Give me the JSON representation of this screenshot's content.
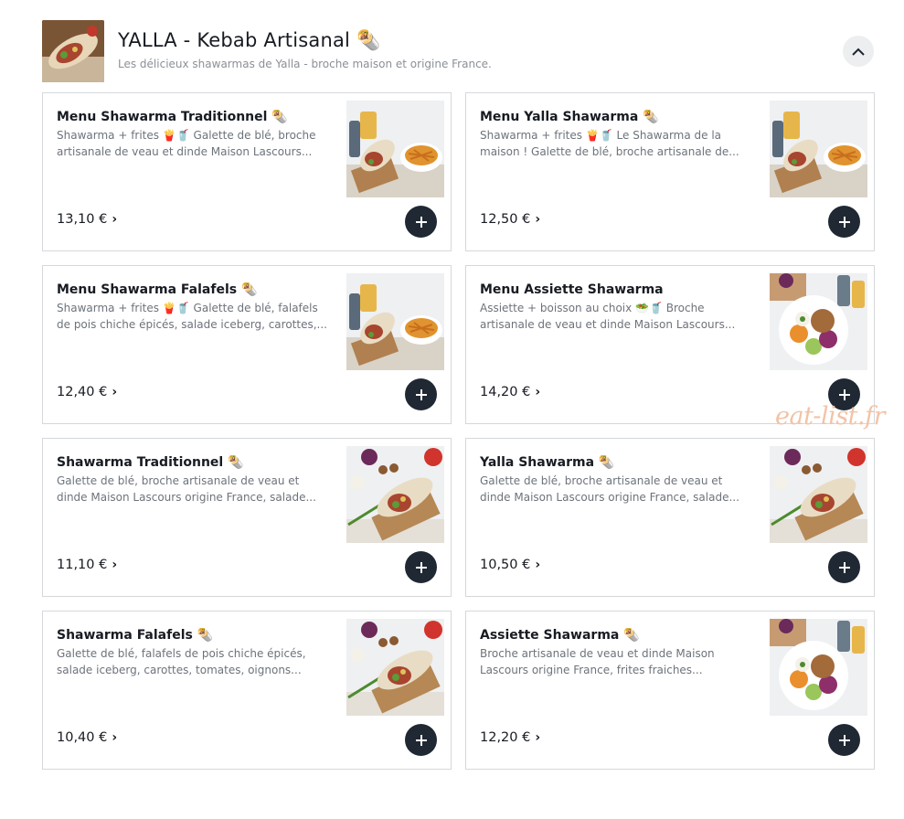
{
  "header": {
    "title": "YALLA - Kebab Artisanal 🌯",
    "subtitle": "Les délicieux shawarmas de Yalla - broche maison et origine France.",
    "logo_icon": "wrap-photo",
    "collapse_icon": "chevron-up-icon"
  },
  "watermark": "eat-list.fr",
  "items": [
    {
      "name": "Menu Shawarma Traditionnel 🌯",
      "description": "Shawarma + frites 🍟🥤 Galette de blé, broche artisanale de veau et dinde Maison Lascours...",
      "price": "13,10 €",
      "photo": "menu-wrap-fries-drink"
    },
    {
      "name": "Menu Yalla Shawarma 🌯",
      "description": "Shawarma + frites 🍟🥤 Le Shawarma de la maison ! Galette de blé, broche artisanale de...",
      "price": "12,50 €",
      "photo": "menu-wrap-fries-drink"
    },
    {
      "name": "Menu Shawarma Falafels 🌯",
      "description": "Shawarma + frites 🍟🥤 Galette de blé, falafels de pois chiche épicés, salade iceberg, carottes,...",
      "price": "12,40 €",
      "photo": "menu-wrap-fries-drink"
    },
    {
      "name": "Menu Assiette Shawarma",
      "description": "Assiette + boisson au choix 🥗🥤 Broche artisanale de veau et dinde Maison Lascours...",
      "price": "14,20 €",
      "photo": "plate-salad"
    },
    {
      "name": "Shawarma Traditionnel 🌯",
      "description": "Galette de blé, broche artisanale de veau et dinde Maison Lascours origine France, salade...",
      "price": "11,10 €",
      "photo": "wrap-board"
    },
    {
      "name": "Yalla Shawarma 🌯",
      "description": "Galette de blé, broche artisanale de veau et dinde Maison Lascours origine France, salade...",
      "price": "10,50 €",
      "photo": "wrap-board"
    },
    {
      "name": "Shawarma Falafels 🌯",
      "description": "Galette de blé, falafels de pois chiche épicés, salade iceberg, carottes, tomates, oignons...",
      "price": "10,40 €",
      "photo": "wrap-board"
    },
    {
      "name": "Assiette Shawarma 🌯",
      "description": "Broche artisanale de veau et dinde Maison Lascours origine France, frites fraiches...",
      "price": "12,20 €",
      "photo": "plate-salad"
    }
  ],
  "colors": {
    "button_dark": "#1f2833",
    "card_border": "#d5d8dc",
    "muted_text": "#6d737b",
    "watermark": "#f2c3a6"
  }
}
